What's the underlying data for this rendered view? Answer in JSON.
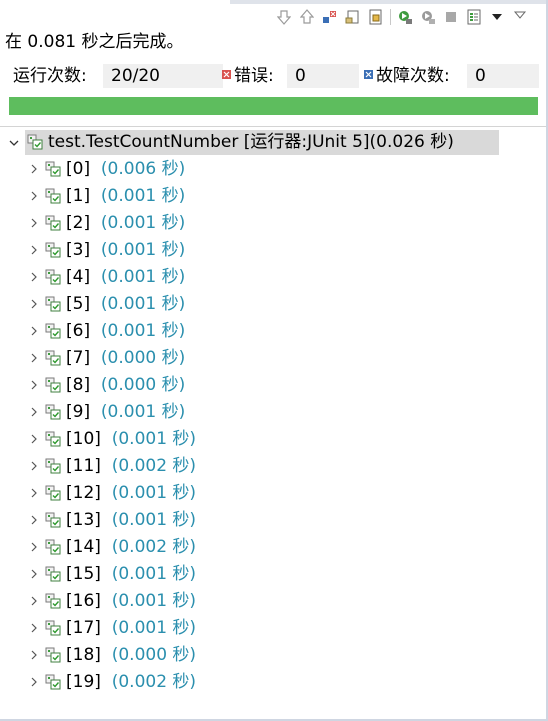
{
  "toolbar": {
    "icons": [
      "next-failure-icon",
      "previous-failure-icon",
      "show-failures-only-icon",
      "scroll-lock-icon",
      "show-skipped-icon",
      "rerun-icon",
      "rerun-failed-first-icon",
      "stop-icon",
      "history-icon",
      "view-menu-icon",
      "minimize-icon"
    ]
  },
  "status": {
    "message": "在 0.081 秒之后完成。"
  },
  "counters": {
    "runs_label": "运行次数:",
    "runs_value": "20/20",
    "errors_label": "错误:",
    "errors_value": "0",
    "failures_label": "故障次数:",
    "failures_value": "0"
  },
  "progress": {
    "fraction": 1.0,
    "color": "#5ebd5e"
  },
  "tree": {
    "root": {
      "label": "test.TestCountNumber [运行器:JUnit 5]",
      "time": "(0.026 秒)"
    },
    "items": [
      {
        "index": "[0]",
        "time": "(0.006 秒)"
      },
      {
        "index": "[1]",
        "time": "(0.001 秒)"
      },
      {
        "index": "[2]",
        "time": "(0.001 秒)"
      },
      {
        "index": "[3]",
        "time": "(0.001 秒)"
      },
      {
        "index": "[4]",
        "time": "(0.001 秒)"
      },
      {
        "index": "[5]",
        "time": "(0.001 秒)"
      },
      {
        "index": "[6]",
        "time": "(0.001 秒)"
      },
      {
        "index": "[7]",
        "time": "(0.000 秒)"
      },
      {
        "index": "[8]",
        "time": "(0.000 秒)"
      },
      {
        "index": "[9]",
        "time": "(0.001 秒)"
      },
      {
        "index": "[10]",
        "time": "(0.001 秒)"
      },
      {
        "index": "[11]",
        "time": "(0.002 秒)"
      },
      {
        "index": "[12]",
        "time": "(0.001 秒)"
      },
      {
        "index": "[13]",
        "time": "(0.001 秒)"
      },
      {
        "index": "[14]",
        "time": "(0.002 秒)"
      },
      {
        "index": "[15]",
        "time": "(0.001 秒)"
      },
      {
        "index": "[16]",
        "time": "(0.001 秒)"
      },
      {
        "index": "[17]",
        "time": "(0.001 秒)"
      },
      {
        "index": "[18]",
        "time": "(0.000 秒)"
      },
      {
        "index": "[19]",
        "time": "(0.002 秒)"
      }
    ]
  },
  "colors": {
    "time_text": "#2b8fae",
    "progress_ok": "#5ebd5e",
    "selection": "#d9d9d9"
  }
}
